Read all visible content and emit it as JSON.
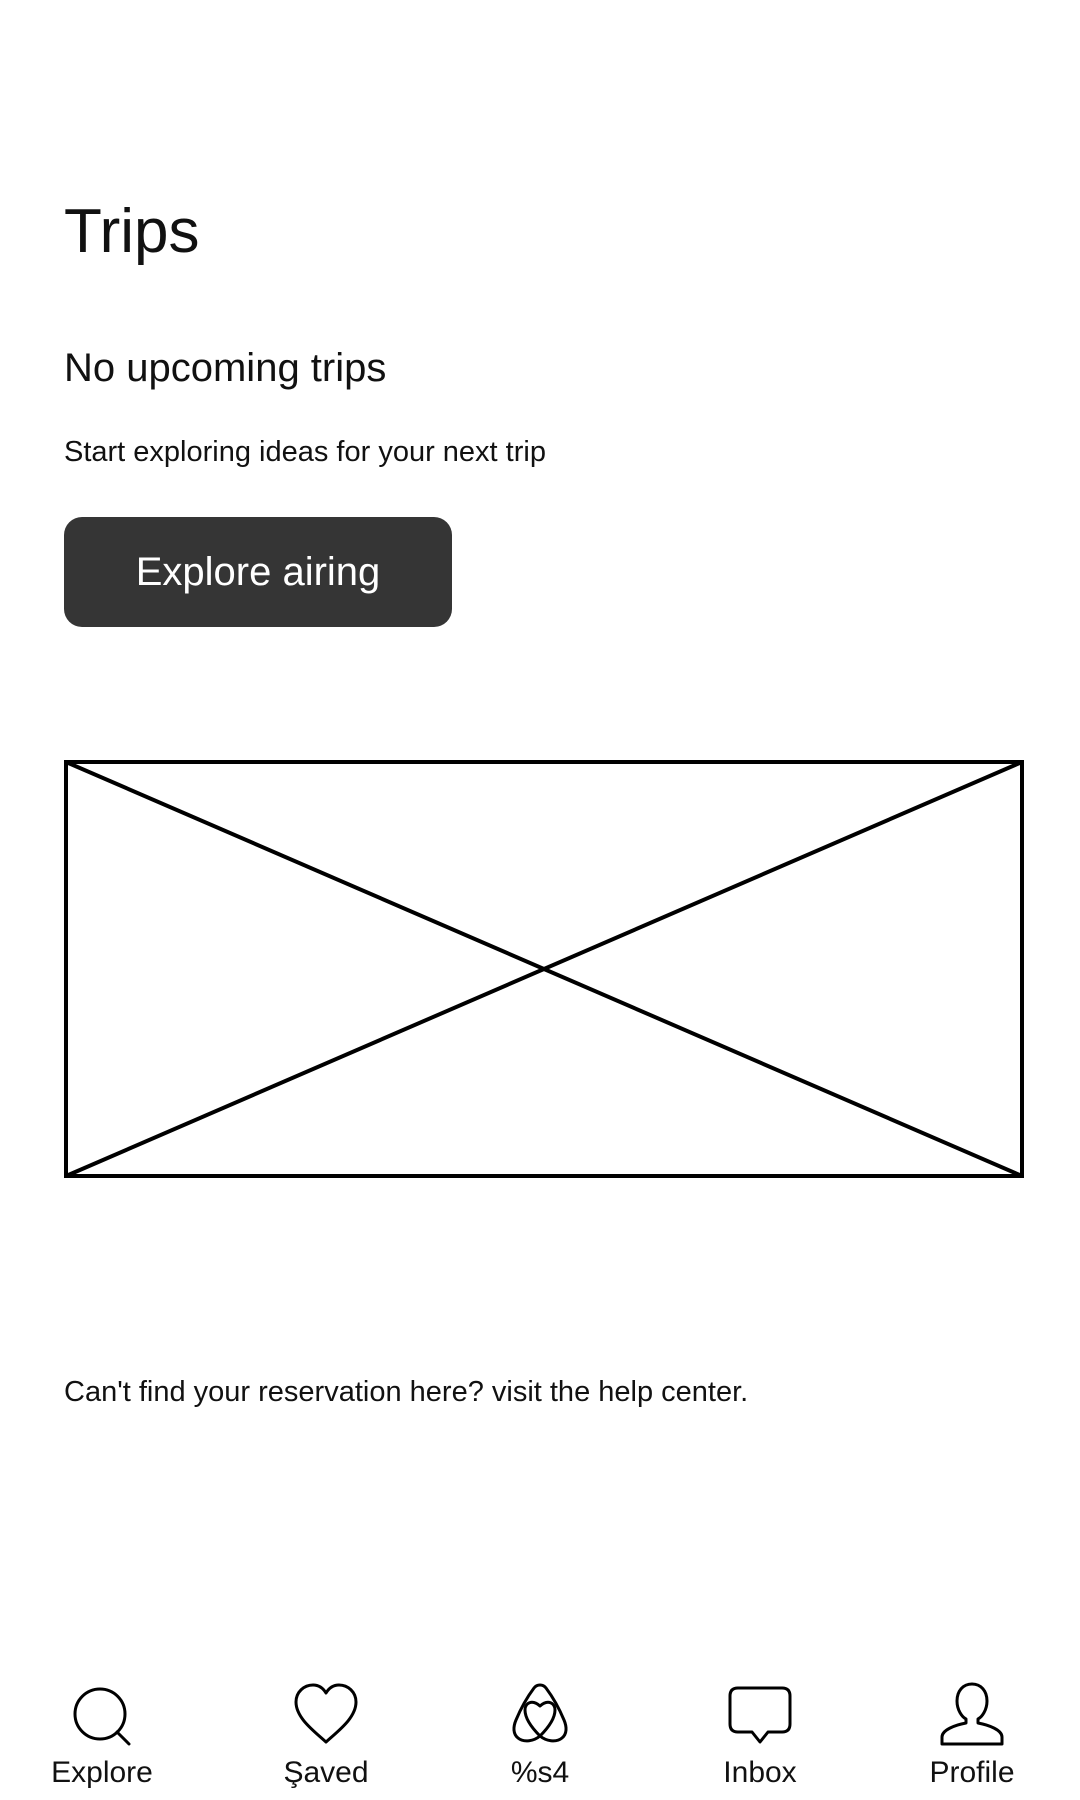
{
  "header": {
    "title": "Trips"
  },
  "empty_state": {
    "title": "No upcoming trips",
    "subtitle": "Start exploring ideas for your next trip",
    "button_label": "Explore airing"
  },
  "help": {
    "text": "Can't find your reservation here? visit the help center."
  },
  "tab_bar": {
    "items": [
      {
        "label": "Explore",
        "icon": "search-icon"
      },
      {
        "label": "Şaved",
        "icon": "heart-icon"
      },
      {
        "label": "%s4",
        "icon": "airbnb-logo-icon"
      },
      {
        "label": "Inbox",
        "icon": "chat-bubble-icon"
      },
      {
        "label": "Profile",
        "icon": "user-icon"
      }
    ]
  }
}
